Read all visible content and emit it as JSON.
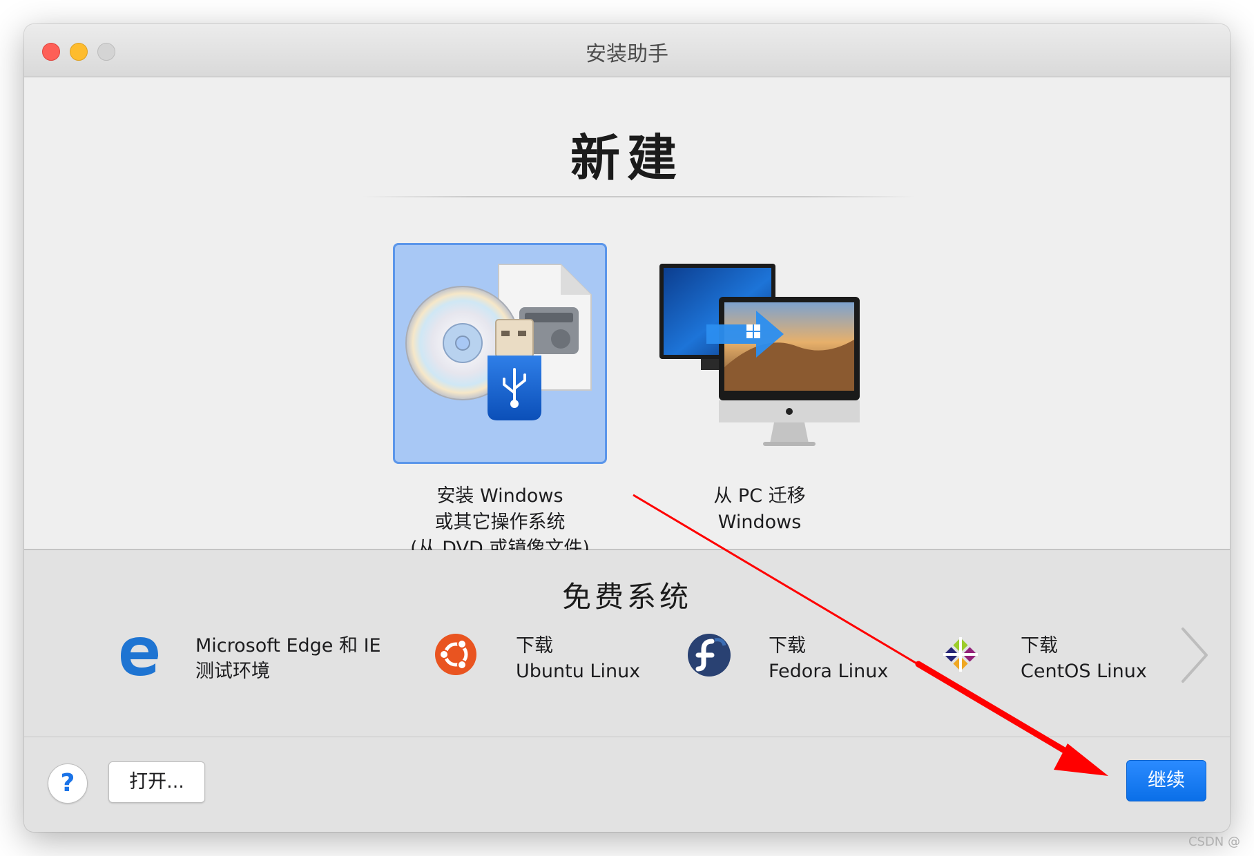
{
  "window": {
    "title": "安装助手"
  },
  "new_section": {
    "title": "新建",
    "options": [
      {
        "lines": [
          "安装 Windows",
          "或其它操作系统",
          "(从 DVD 或镜像文件)"
        ],
        "selected": true
      },
      {
        "lines": [
          "从 PC 迁移",
          "Windows"
        ],
        "selected": false
      }
    ]
  },
  "free_section": {
    "title": "免费系统",
    "items": [
      {
        "lines": [
          "Microsoft Edge 和 IE",
          "测试环境"
        ],
        "icon": "edge-icon"
      },
      {
        "lines": [
          "下载",
          "Ubuntu Linux"
        ],
        "icon": "ubuntu-icon"
      },
      {
        "lines": [
          "下载",
          "Fedora Linux"
        ],
        "icon": "fedora-icon"
      },
      {
        "lines": [
          "下载",
          "CentOS Linux"
        ],
        "icon": "centos-icon"
      }
    ]
  },
  "buttons": {
    "help": "?",
    "open": "打开...",
    "continue": "继续"
  },
  "colors": {
    "accent": "#0a6fe8",
    "selection_fill": "#a8c8f5",
    "selection_border": "#5b96ea",
    "annotation_arrow": "#ff0000"
  },
  "watermark": "CSDN @"
}
